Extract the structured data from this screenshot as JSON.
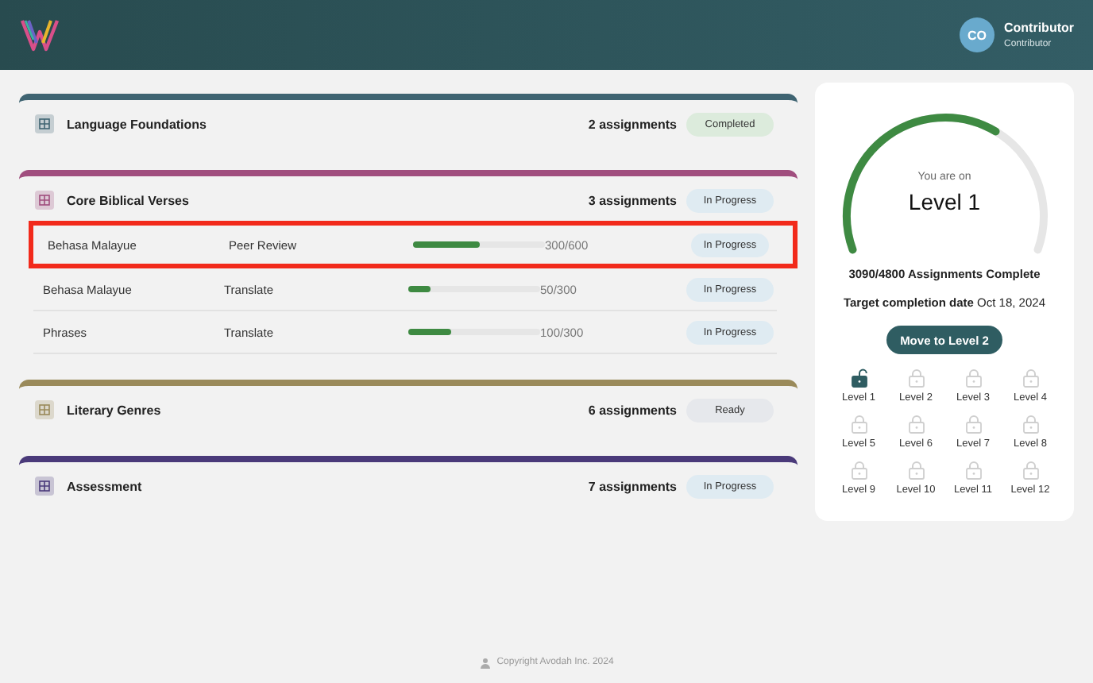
{
  "header": {
    "avatar_initials": "CO",
    "user_name": "Contributor",
    "user_role": "Contributor"
  },
  "sections": [
    {
      "title": "Language Foundations",
      "color": "#3f6472",
      "count": "2 assignments",
      "status": "Completed",
      "kind": "completed"
    },
    {
      "title": "Core Biblical Verses",
      "color": "#a04e7e",
      "count": "3 assignments",
      "status": "In Progress",
      "kind": "progress",
      "rows": [
        {
          "name": "Behasa Malayue",
          "task": "Peer Review",
          "level": 0.5,
          "reading": "300/600",
          "status": "In Progress",
          "highlighted": true
        },
        {
          "name": "Behasa Malayue",
          "task": "Translate",
          "level": 0.17,
          "reading": "50/300",
          "status": "In Progress",
          "highlighted": false
        },
        {
          "name": "Phrases",
          "task": "Translate",
          "level": 0.33,
          "reading": "100/300",
          "status": "In Progress",
          "highlighted": false
        }
      ]
    },
    {
      "title": "Literary Genres",
      "color": "#9a8a5a",
      "count": "6 assignments",
      "status": "Ready",
      "kind": "ready"
    },
    {
      "title": "Assessment",
      "color": "#4a3a7a",
      "count": "7 assignments",
      "status": "In Progress",
      "kind": "progress"
    }
  ],
  "progress_card": {
    "caption": "You are on",
    "current_level": "Level 1",
    "level": 0.64,
    "complete_text": "3090/4800 Assignments Complete",
    "target_label": "Target completion date",
    "target_date": "Oct 18, 2024",
    "button": "Move to Level 2",
    "levels": [
      {
        "label": "Level 1",
        "unlocked": true
      },
      {
        "label": "Level 2",
        "unlocked": false
      },
      {
        "label": "Level 3",
        "unlocked": false
      },
      {
        "label": "Level 4",
        "unlocked": false
      },
      {
        "label": "Level 5",
        "unlocked": false
      },
      {
        "label": "Level 6",
        "unlocked": false
      },
      {
        "label": "Level 7",
        "unlocked": false
      },
      {
        "label": "Level 8",
        "unlocked": false
      },
      {
        "label": "Level 9",
        "unlocked": false
      },
      {
        "label": "Level 10",
        "unlocked": false
      },
      {
        "label": "Level 11",
        "unlocked": false
      },
      {
        "label": "Level 12",
        "unlocked": false
      }
    ]
  },
  "footer": {
    "copyright": "Copyright Avodah Inc. 2024"
  }
}
